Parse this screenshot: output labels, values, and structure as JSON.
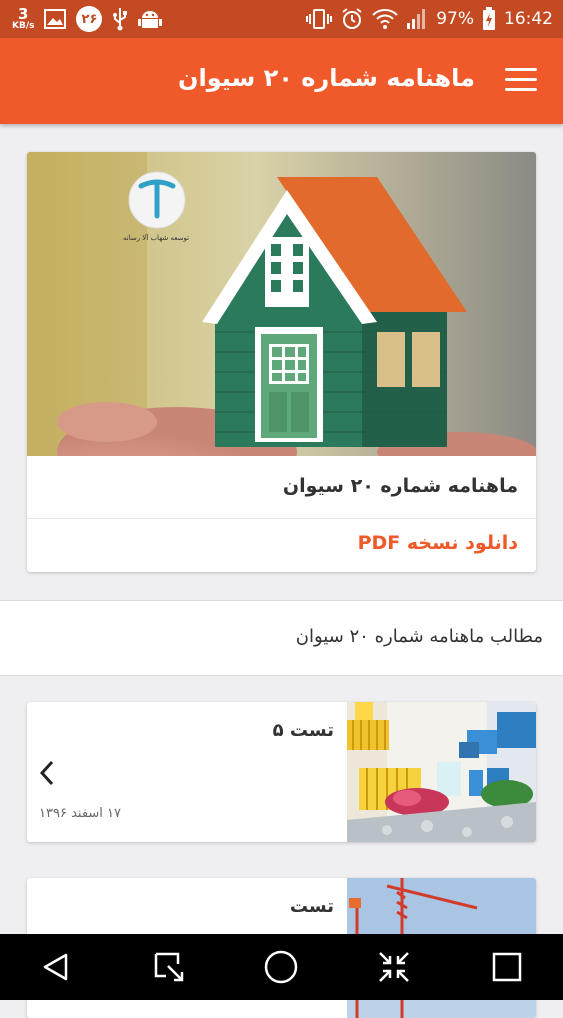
{
  "status_bar": {
    "net_speed_value": "3",
    "net_speed_unit": "KB/s",
    "notification_count": "۲۶",
    "battery_percent": "97%",
    "time": "16:42"
  },
  "app_bar": {
    "title": "ماهنامه شماره ۲۰ سیوان"
  },
  "hero": {
    "logo_caption": "توسعه شهاب آلا رسانه",
    "title": "ماهنامه شماره ۲۰ سیوان",
    "download_label": "دانلود نسخه PDF"
  },
  "section": {
    "title": "مطالب ماهنامه شماره ۲۰ سیوان"
  },
  "items": [
    {
      "title": "تست ۵",
      "date": "۱۷ اسفند ۱۳۹۶"
    },
    {
      "title": "تست"
    }
  ]
}
